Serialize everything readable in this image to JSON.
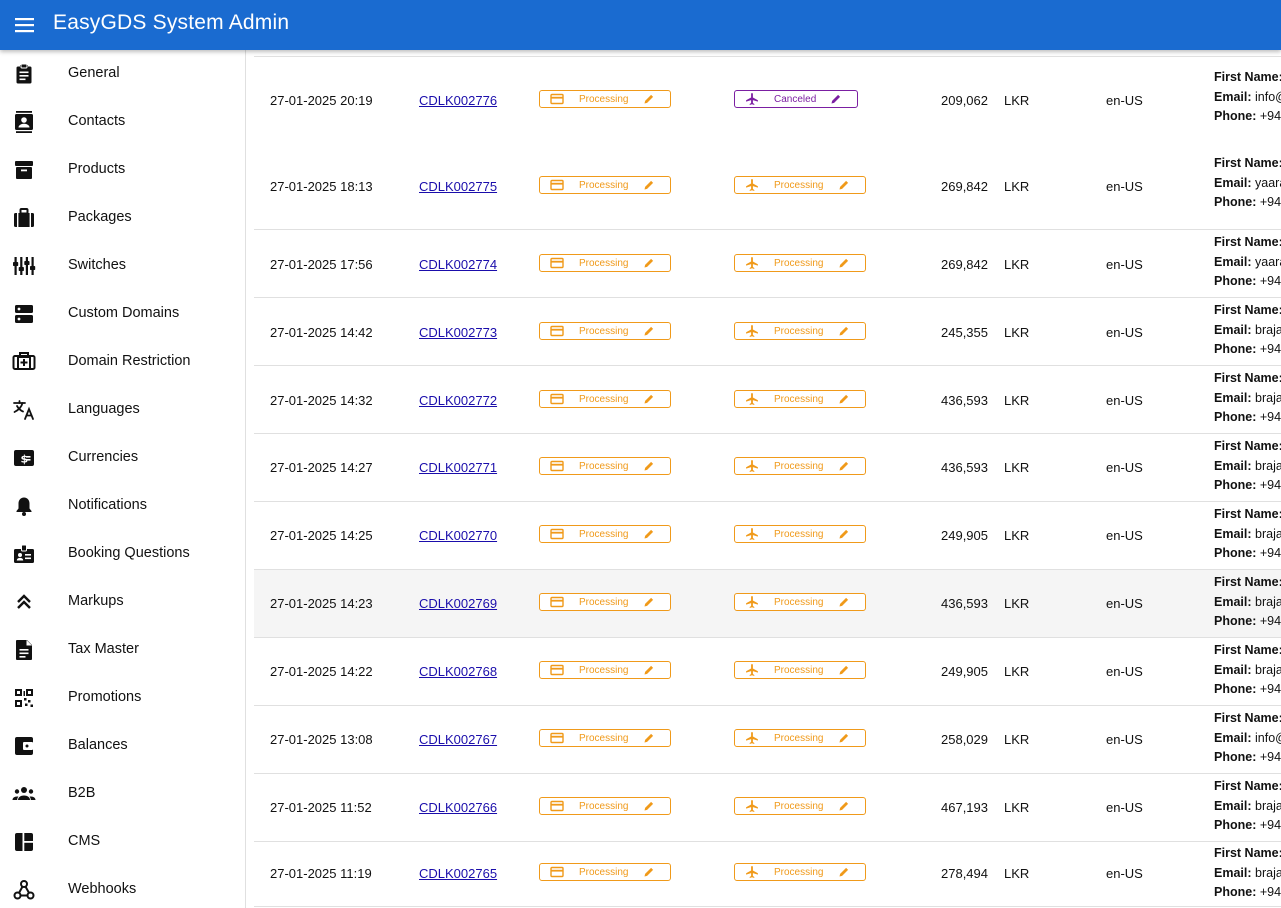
{
  "app": {
    "title": "EasyGDS System Admin"
  },
  "colors": {
    "appbar": "#1a6bd0",
    "processing": "#f09a1a",
    "canceled": "#7b1fa2",
    "link": "#1a0dab"
  },
  "sidebar": {
    "items": [
      {
        "label": "General",
        "icon": "clipboard-icon"
      },
      {
        "label": "Contacts",
        "icon": "contacts-icon"
      },
      {
        "label": "Products",
        "icon": "archive-icon"
      },
      {
        "label": "Packages",
        "icon": "briefcase-icon"
      },
      {
        "label": "Switches",
        "icon": "sliders-icon"
      },
      {
        "label": "Custom Domains",
        "icon": "dns-icon"
      },
      {
        "label": "Domain Restriction",
        "icon": "restriction-icon"
      },
      {
        "label": "Languages",
        "icon": "translate-icon"
      },
      {
        "label": "Currencies",
        "icon": "currency-icon"
      },
      {
        "label": "Notifications",
        "icon": "bell-icon"
      },
      {
        "label": "Booking Questions",
        "icon": "badge-icon"
      },
      {
        "label": "Markups",
        "icon": "double-chevron-up-icon"
      },
      {
        "label": "Tax Master",
        "icon": "document-icon"
      },
      {
        "label": "Promotions",
        "icon": "qr-code-icon"
      },
      {
        "label": "Balances",
        "icon": "wallet-icon"
      },
      {
        "label": "B2B",
        "icon": "people-icon"
      },
      {
        "label": "CMS",
        "icon": "dashboard-icon"
      },
      {
        "label": "Webhooks",
        "icon": "webhook-icon"
      }
    ]
  },
  "table": {
    "labels": {
      "first_name": "First Name:",
      "email": "Email:",
      "phone": "Phone:"
    },
    "rows": [
      {
        "date": "27-01-2025 20:19",
        "ref": "CDLK002776",
        "payment_status": "Processing",
        "flight_status": "Canceled",
        "amount": "209,062",
        "currency": "LKR",
        "locale": "en-US",
        "email": "info@",
        "phone": "+94"
      },
      {
        "date": "27-01-2025 18:13",
        "ref": "CDLK002775",
        "payment_status": "Processing",
        "flight_status": "Processing",
        "amount": "269,842",
        "currency": "LKR",
        "locale": "en-US",
        "email": "yaara",
        "phone": "+94"
      },
      {
        "date": "27-01-2025 17:56",
        "ref": "CDLK002774",
        "payment_status": "Processing",
        "flight_status": "Processing",
        "amount": "269,842",
        "currency": "LKR",
        "locale": "en-US",
        "email": "yaara",
        "phone": "+94"
      },
      {
        "date": "27-01-2025 14:42",
        "ref": "CDLK002773",
        "payment_status": "Processing",
        "flight_status": "Processing",
        "amount": "245,355",
        "currency": "LKR",
        "locale": "en-US",
        "email": "braja",
        "phone": "+94"
      },
      {
        "date": "27-01-2025 14:32",
        "ref": "CDLK002772",
        "payment_status": "Processing",
        "flight_status": "Processing",
        "amount": "436,593",
        "currency": "LKR",
        "locale": "en-US",
        "email": "braja",
        "phone": "+94"
      },
      {
        "date": "27-01-2025 14:27",
        "ref": "CDLK002771",
        "payment_status": "Processing",
        "flight_status": "Processing",
        "amount": "436,593",
        "currency": "LKR",
        "locale": "en-US",
        "email": "braja",
        "phone": "+94"
      },
      {
        "date": "27-01-2025 14:25",
        "ref": "CDLK002770",
        "payment_status": "Processing",
        "flight_status": "Processing",
        "amount": "249,905",
        "currency": "LKR",
        "locale": "en-US",
        "email": "braja",
        "phone": "+94"
      },
      {
        "date": "27-01-2025 14:23",
        "ref": "CDLK002769",
        "payment_status": "Processing",
        "flight_status": "Processing",
        "amount": "436,593",
        "currency": "LKR",
        "locale": "en-US",
        "email": "braja",
        "phone": "+94"
      },
      {
        "date": "27-01-2025 14:22",
        "ref": "CDLK002768",
        "payment_status": "Processing",
        "flight_status": "Processing",
        "amount": "249,905",
        "currency": "LKR",
        "locale": "en-US",
        "email": "braja",
        "phone": "+94"
      },
      {
        "date": "27-01-2025 13:08",
        "ref": "CDLK002767",
        "payment_status": "Processing",
        "flight_status": "Processing",
        "amount": "258,029",
        "currency": "LKR",
        "locale": "en-US",
        "email": "info@",
        "phone": "+94"
      },
      {
        "date": "27-01-2025 11:52",
        "ref": "CDLK002766",
        "payment_status": "Processing",
        "flight_status": "Processing",
        "amount": "467,193",
        "currency": "LKR",
        "locale": "en-US",
        "email": "braja",
        "phone": "+94"
      },
      {
        "date": "27-01-2025 11:19",
        "ref": "CDLK002765",
        "payment_status": "Processing",
        "flight_status": "Processing",
        "amount": "278,494",
        "currency": "LKR",
        "locale": "en-US",
        "email": "braja",
        "phone": "+94"
      }
    ]
  }
}
